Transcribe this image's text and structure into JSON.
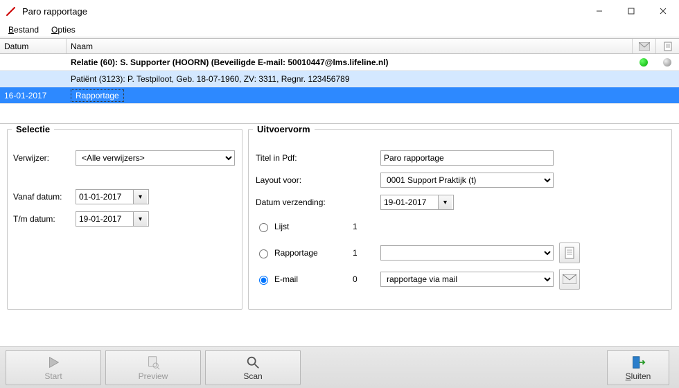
{
  "window": {
    "title": "Paro rapportage"
  },
  "menu": {
    "bestand": "Bestand",
    "opties": "Opties"
  },
  "grid": {
    "header": {
      "datum": "Datum",
      "naam": "Naam"
    },
    "relatie": {
      "naam": "Relatie (60): S. Supporter (HOORN)  (Beveiligde E-mail: 50010447@lms.lifeline.nl)"
    },
    "patient": {
      "naam": "Patiënt (3123): P. Testpiloot, Geb. 18-07-1960,  ZV: 3311,  Regnr. 123456789"
    },
    "rapport": {
      "datum": "16-01-2017",
      "naam": "Rapportage"
    }
  },
  "selectie": {
    "legend": "Selectie",
    "verwijzer_label": "Verwijzer:",
    "verwijzer_value": "<Alle verwijzers>",
    "vanaf_label": "Vanaf datum:",
    "vanaf_value": "01-01-2017",
    "tm_label": "T/m datum:",
    "tm_value": "19-01-2017"
  },
  "uitvoer": {
    "legend": "Uitvoervorm",
    "titel_label": "Titel in Pdf:",
    "titel_value": "Paro rapportage",
    "layout_label": "Layout voor:",
    "layout_value": "0001 Support Praktijk (t)",
    "datum_label": "Datum verzending:",
    "datum_value": "19-01-2017",
    "lijst_label": "Lijst",
    "lijst_count": "1",
    "rapportage_label": "Rapportage",
    "rapportage_count": "1",
    "rapportage_combo": "",
    "email_label": "E-mail",
    "email_count": "0",
    "email_combo": "rapportage via mail"
  },
  "toolbar": {
    "start": "Start",
    "preview": "Preview",
    "scan": "Scan",
    "sluiten": "Sluiten"
  }
}
